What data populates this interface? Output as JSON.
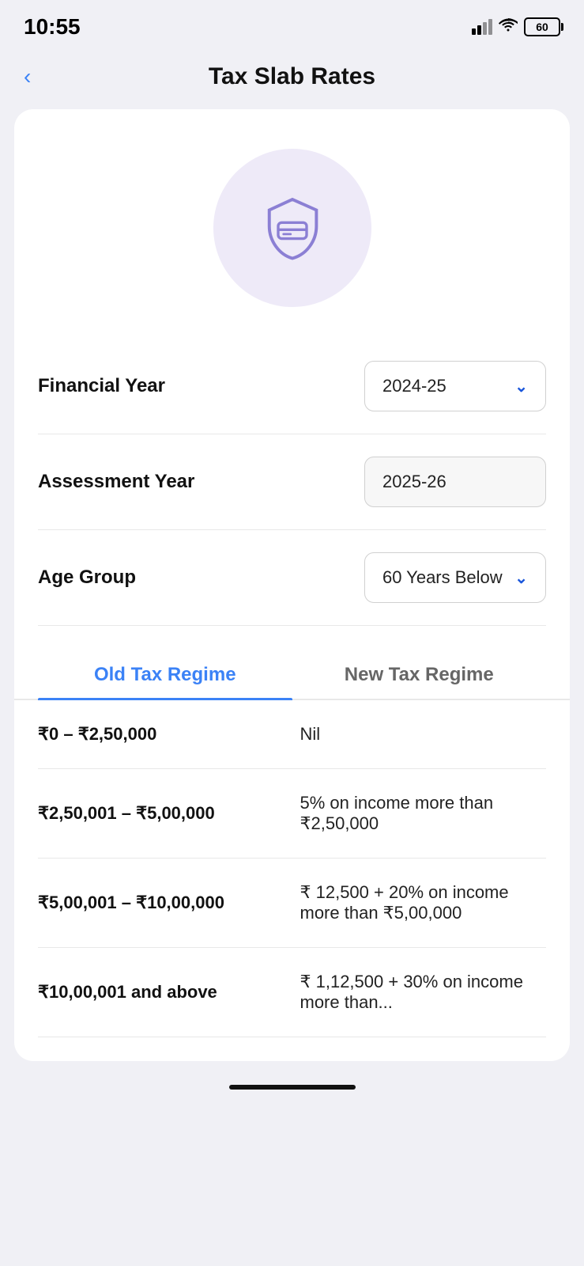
{
  "statusBar": {
    "time": "10:55",
    "battery": "60"
  },
  "header": {
    "backLabel": "‹",
    "title": "Tax Slab Rates"
  },
  "form": {
    "financialYearLabel": "Financial Year",
    "financialYearValue": "2024-25",
    "assessmentYearLabel": "Assessment Year",
    "assessmentYearValue": "2025-26",
    "ageGroupLabel": "Age Group",
    "ageGroupValue": "60 Years Below"
  },
  "tabs": [
    {
      "id": "old",
      "label": "Old Tax Regime",
      "active": true
    },
    {
      "id": "new",
      "label": "New Tax Regime",
      "active": false
    }
  ],
  "slabs": [
    {
      "range": "₹0 – ₹2,50,000",
      "rate": "Nil"
    },
    {
      "range": "₹2,50,001 – ₹5,00,000",
      "rate": "5% on income more than ₹2,50,000"
    },
    {
      "range": "₹5,00,001 – ₹10,00,000",
      "rate": "₹ 12,500 + 20% on income more than ₹5,00,000"
    },
    {
      "range": "₹10,00,001 and above",
      "rate": "₹ 1,12,500 + 30% on income more than..."
    }
  ]
}
